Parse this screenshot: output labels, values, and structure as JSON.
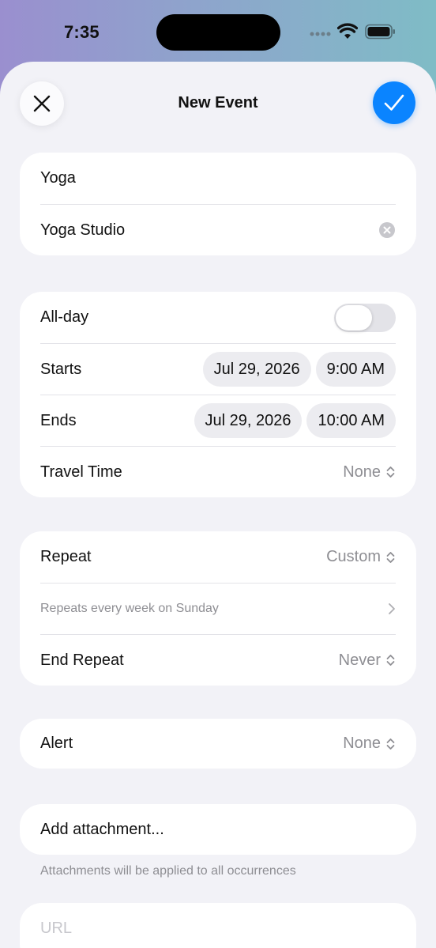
{
  "status": {
    "time": "7:35"
  },
  "header": {
    "title": "New Event"
  },
  "event": {
    "title": "Yoga",
    "location": "Yoga Studio"
  },
  "timing": {
    "allday_label": "All-day",
    "allday_on": false,
    "starts_label": "Starts",
    "starts_date": "Jul 29, 2026",
    "starts_time": "9:00 AM",
    "ends_label": "Ends",
    "ends_date": "Jul 29, 2026",
    "ends_time": "10:00 AM",
    "travel_label": "Travel Time",
    "travel_value": "None"
  },
  "repeat": {
    "label": "Repeat",
    "value": "Custom",
    "summary": "Repeats every week on Sunday",
    "end_label": "End Repeat",
    "end_value": "Never"
  },
  "alert": {
    "label": "Alert",
    "value": "None"
  },
  "attachment": {
    "label": "Add attachment...",
    "note": "Attachments will be applied to all occurrences"
  },
  "url": {
    "placeholder": "URL"
  },
  "colors": {
    "accent": "#0a84ff",
    "sheet_bg": "#f2f2f7",
    "card_bg": "#ffffff",
    "secondary_text": "#8e8e93"
  }
}
